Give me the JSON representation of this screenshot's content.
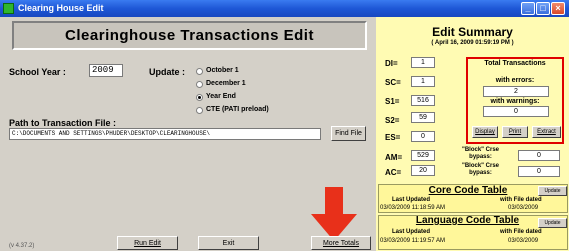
{
  "window": {
    "title": "Clearing House Edit",
    "min": "_",
    "max": "□",
    "close": "×"
  },
  "header": {
    "title": "Clearinghouse Transactions Edit"
  },
  "school_year": {
    "label": "School Year :",
    "value": "2009"
  },
  "update": {
    "label": "Update :",
    "options": [
      "October 1",
      "December 1",
      "Year End",
      "CTE (PATI preload)"
    ],
    "selected": "Year End"
  },
  "path": {
    "label": "Path to Transaction File :",
    "value": "C:\\DOCUMENTS AND SETTINGS\\PHUDER\\DESKTOP\\CLEARINGHOUSE\\",
    "find_button": "Find File"
  },
  "footer": {
    "version": "(v 4.37.2)",
    "run_edit": "Run Edit",
    "exit": "Exit",
    "more_totals": "More Totals"
  },
  "summary": {
    "title": "Edit Summary",
    "date": "( April 16, 2009   01:59:19 PM )",
    "counts": [
      {
        "label": "DI=",
        "value": "1"
      },
      {
        "label": "SC=",
        "value": "1"
      },
      {
        "label": "S1=",
        "value": "516"
      },
      {
        "label": "S2=",
        "value": "59"
      },
      {
        "label": "ES=",
        "value": "0"
      },
      {
        "label": "AM=",
        "value": "529"
      },
      {
        "label": "AC=",
        "value": "20"
      }
    ],
    "total_title": "Total Transactions",
    "with_errors_label": "with errors:",
    "errors_value": "2",
    "with_warnings_label": "with warnings:",
    "warnings_value": "0",
    "display": "Display",
    "print": "Print",
    "extract": "Extract",
    "block_label_1": "\"Block\" Crse bypass:",
    "block_value_1": "0",
    "block_label_2": "\"Block\" Crse bypass:",
    "block_value_2": "0"
  },
  "core_table": {
    "title": "Core Code Table",
    "update": "Update",
    "last_updated_label": "Last Updated",
    "file_dated_label": "with File dated",
    "last_updated": "03/03/2009  11:18:59 AM",
    "file_dated": "03/03/2009"
  },
  "language_table": {
    "title": "Language Code Table",
    "update": "Update",
    "last_updated_label": "Last Updated",
    "file_dated_label": "with File dated",
    "last_updated": "03/03/2009  11:19:57 AM",
    "file_dated": "03/03/2009"
  },
  "colors": {
    "titlebar": "#1e57d6",
    "summary_bg": "#fffbb3",
    "arrow": "#e8301a",
    "errors_border": "#e00000"
  }
}
